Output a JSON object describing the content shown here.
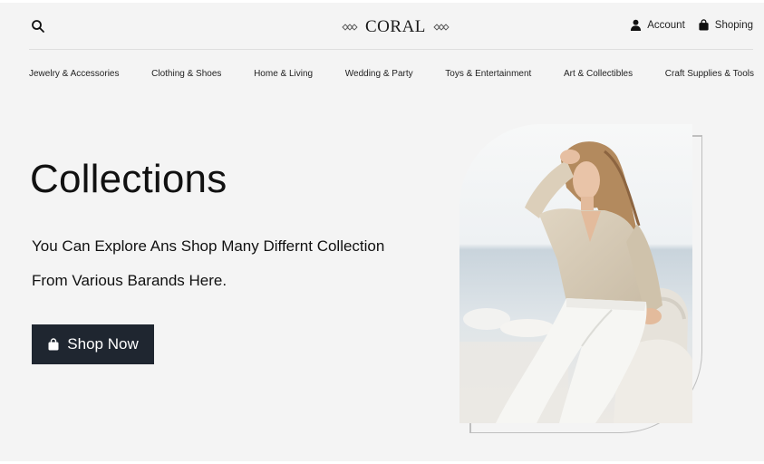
{
  "header": {
    "logo_text": "CORAL",
    "account_label": "Account",
    "shopping_label": "Shoping"
  },
  "nav": {
    "items": [
      "Jewelry & Accessories",
      "Clothing & Shoes",
      "Home & Living",
      "Wedding & Party",
      "Toys & Entertainment",
      "Art & Collectibles",
      "Craft Supplies & Tools"
    ]
  },
  "hero": {
    "title": "Collections",
    "subtitle_line1": "You Can Explore Ans Shop Many Differnt Collection",
    "subtitle_line2": "From Various Barands Here.",
    "button_label": "Shop Now"
  },
  "colors": {
    "background": "#f4f4f4",
    "button": "#1f2630",
    "text": "#111111"
  },
  "icons": [
    "search-icon",
    "user-icon",
    "bag-icon",
    "logo-ornament-icon"
  ]
}
